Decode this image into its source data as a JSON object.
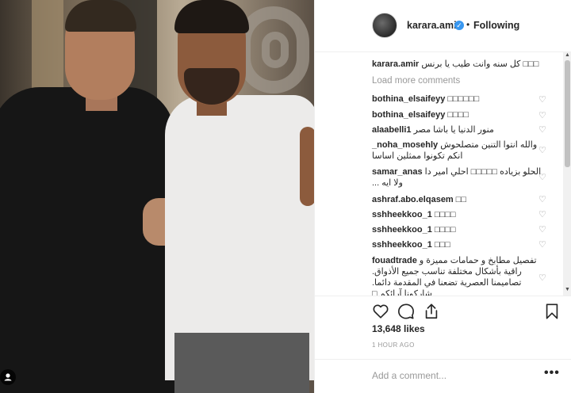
{
  "post": {
    "username": "karara.amir",
    "verified_mark": "✓",
    "separator": "•",
    "follow_status": "Following",
    "caption_user": "karara.amir",
    "caption_text": "□□□ كل سنه وانت طيب يا برنس"
  },
  "comments_section": {
    "load_more": "Load more comments",
    "items": [
      {
        "user": "bothina_elsaifeyy",
        "text": "□□□□□□"
      },
      {
        "user": "bothina_elsaifeyy",
        "text": "□□□□"
      },
      {
        "user": "alaabelli1",
        "text": "منور الدنيا يا باشا مصر"
      },
      {
        "user": "_noha_mosehly",
        "text": "والله انتوا التنين متصلحوش انكم تكونوا ممثلين اساسا"
      },
      {
        "user": "samar_anas",
        "text": "الحلو بزياده □□□□□ احلي امير دا ولا ايه ..."
      },
      {
        "user": "ashraf.abo.elqasem",
        "text": "□□"
      },
      {
        "user": "sshheekkoo_1",
        "text": "□□□□"
      },
      {
        "user": "sshheekkoo_1",
        "text": "□□□□"
      },
      {
        "user": "sshheekkoo_1",
        "text": "□□□"
      },
      {
        "user": "fouadtrade",
        "text": "تفصيل مطابخ و حمامات مميزة و راقية بأشكال مختلفة تناسب جميع الأذواق. تصاميمنا العصرية تضعنا في المقدمة دائما. شاركونا آرائكم □"
      }
    ]
  },
  "actions": {
    "likes": "13,648 likes",
    "time": "1 HOUR AGO"
  },
  "add_comment": {
    "placeholder": "Add a comment...",
    "more": "•••"
  },
  "icons": {
    "like": "heart-icon",
    "comment": "comment-bubble-icon",
    "share": "share-icon",
    "save": "bookmark-icon",
    "tag": "person-tag-icon"
  },
  "colors": {
    "verified": "#3897f0",
    "muted": "#999999",
    "text": "#262626"
  }
}
